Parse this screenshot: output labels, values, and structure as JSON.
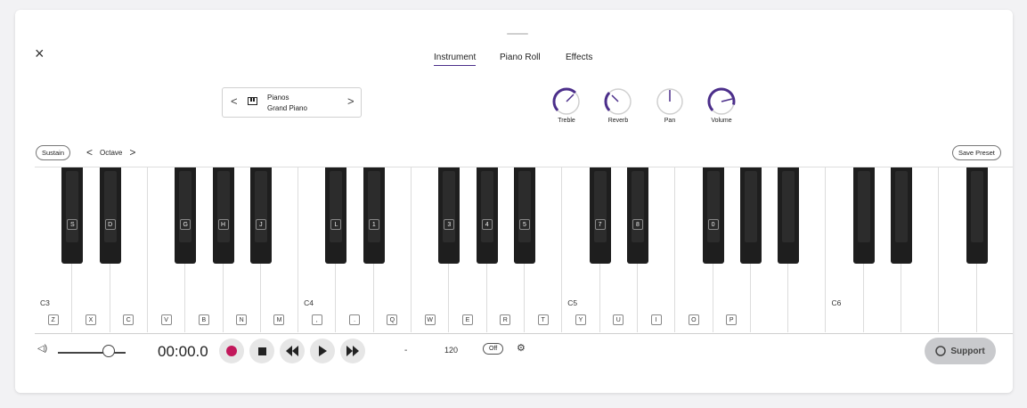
{
  "tabs": [
    {
      "label": "Instrument",
      "active": true
    },
    {
      "label": "Piano Roll",
      "active": false
    },
    {
      "label": "Effects",
      "active": false
    }
  ],
  "instrument": {
    "category": "Pianos",
    "name": "Grand Piano",
    "prev": "<",
    "next": ">"
  },
  "knobs": [
    {
      "label": "Treble"
    },
    {
      "label": "Reverb"
    },
    {
      "label": "Pan"
    },
    {
      "label": "Volume"
    }
  ],
  "controls": {
    "close": "×",
    "sustain": "Sustain",
    "octave_label": "Octave",
    "octave_prev": "<",
    "octave_next": ">",
    "save_preset": "Save Preset"
  },
  "keyboard": {
    "octaves": [
      "C3",
      "C4",
      "C5",
      "C6"
    ],
    "white_keys": [
      "Z",
      "X",
      "C",
      "V",
      "B",
      "N",
      "M",
      ",",
      ".",
      "Q",
      "W",
      "E",
      "R",
      "T",
      "Y",
      "U",
      "I",
      "O",
      "P",
      "",
      "",
      "",
      "",
      "",
      "",
      ""
    ],
    "black_keys": [
      "S",
      "D",
      "G",
      "H",
      "J",
      "L",
      "1",
      "3",
      "4",
      "5",
      "7",
      "8",
      "0",
      "",
      "",
      "",
      "",
      ""
    ]
  },
  "transport": {
    "time": "00:00.0",
    "tempo_dash": "-",
    "tempo": "120",
    "metronome": "Off",
    "volume_level": 0.7
  },
  "support": {
    "label": "Support"
  },
  "colors": {
    "accent": "#4b2e8a",
    "record": "#c2185b"
  }
}
